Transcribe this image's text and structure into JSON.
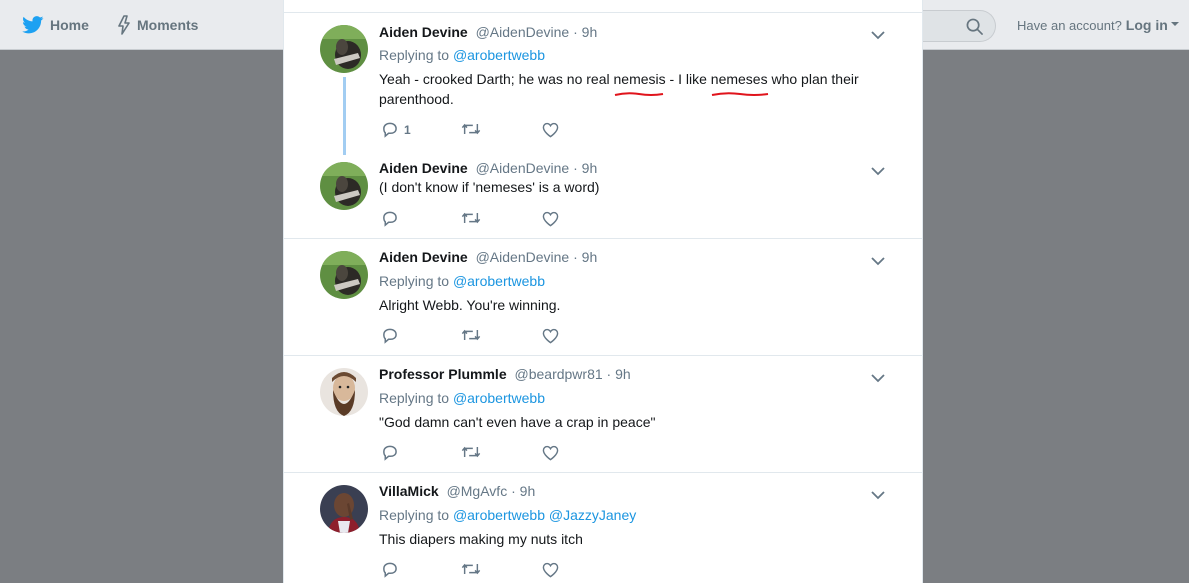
{
  "nav": {
    "home_label": "Home",
    "moments_label": "Moments"
  },
  "account": {
    "prompt": "Have an account?",
    "login_label": "Log in"
  },
  "icons": {
    "brand": "twitter-bird-icon",
    "moments": "lightning-icon",
    "search": "search-icon"
  },
  "colors": {
    "link": "#1b95e0",
    "squiggle": "#e0141c",
    "thread_line": "#a2cdf2"
  },
  "tweets": [
    {
      "fullname": "Aiden Devine",
      "username": "@AidenDevine",
      "sep": "·",
      "time": "9h",
      "replying_prefix": "Replying to",
      "mentions": [
        "@arobertwebb"
      ],
      "text_parts": [
        "Yeah - crooked Darth; he was no real ",
        "nemesis",
        " - I like ",
        "nemeses",
        " who plan their parenthood."
      ],
      "reply_count": "1"
    },
    {
      "fullname": "Aiden Devine",
      "username": "@AidenDevine",
      "sep": "·",
      "time": "9h",
      "text": "(I don't know if 'nemeses' is a word)"
    },
    {
      "fullname": "Aiden Devine",
      "username": "@AidenDevine",
      "sep": "·",
      "time": "9h",
      "replying_prefix": "Replying to",
      "mentions": [
        "@arobertwebb"
      ],
      "text": "Alright Webb. You're winning."
    },
    {
      "fullname": "Professor Plummle",
      "username": "@beardpwr81",
      "sep": "·",
      "time": "9h",
      "replying_prefix": "Replying to",
      "mentions": [
        "@arobertwebb"
      ],
      "text": "\"God damn can't even have a crap in peace\""
    },
    {
      "fullname": "VillaMick",
      "username": "@MgAvfc",
      "sep": "·",
      "time": "9h",
      "replying_prefix": "Replying to",
      "mentions": [
        "@arobertwebb",
        "@JazzyJaney"
      ],
      "text": "This diapers making my nuts itch"
    }
  ]
}
